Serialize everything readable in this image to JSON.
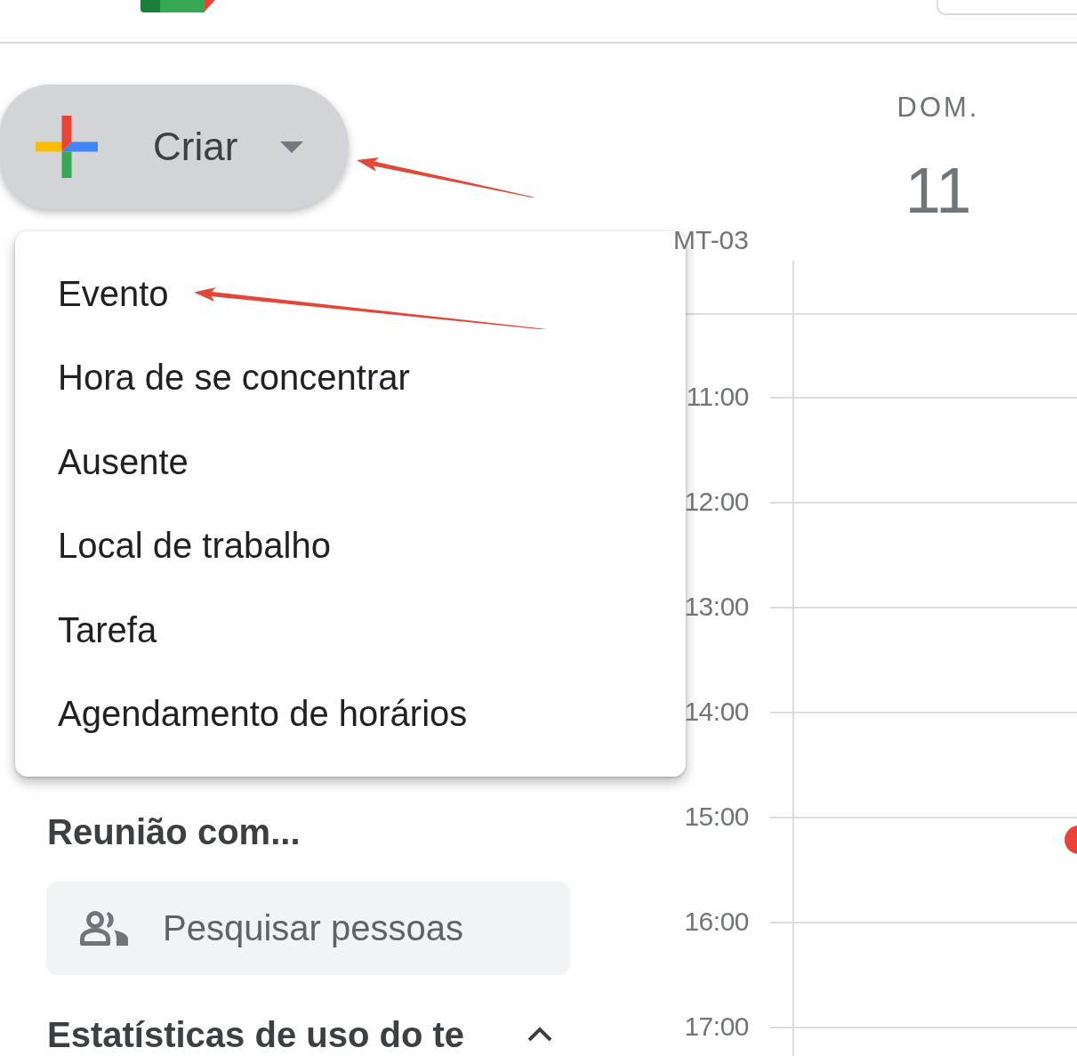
{
  "create_button": {
    "label": "Criar"
  },
  "create_menu": {
    "items": [
      {
        "label": "Evento"
      },
      {
        "label": "Hora de se concentrar"
      },
      {
        "label": "Ausente"
      },
      {
        "label": "Local de trabalho"
      },
      {
        "label": "Tarefa"
      },
      {
        "label": "Agendamento de horários"
      }
    ]
  },
  "meet_with": {
    "title": "Reunião com...",
    "search": {
      "placeholder": "Pesquisar pessoas"
    }
  },
  "time_insights": {
    "title": "Estatísticas de uso do te",
    "expanded": true
  },
  "day_view": {
    "weekday": "DOM.",
    "date": "11",
    "timezone": "MT-03",
    "hours": [
      "11:00",
      "12:00",
      "13:00",
      "14:00",
      "15:00",
      "16:00",
      "17:00"
    ]
  }
}
